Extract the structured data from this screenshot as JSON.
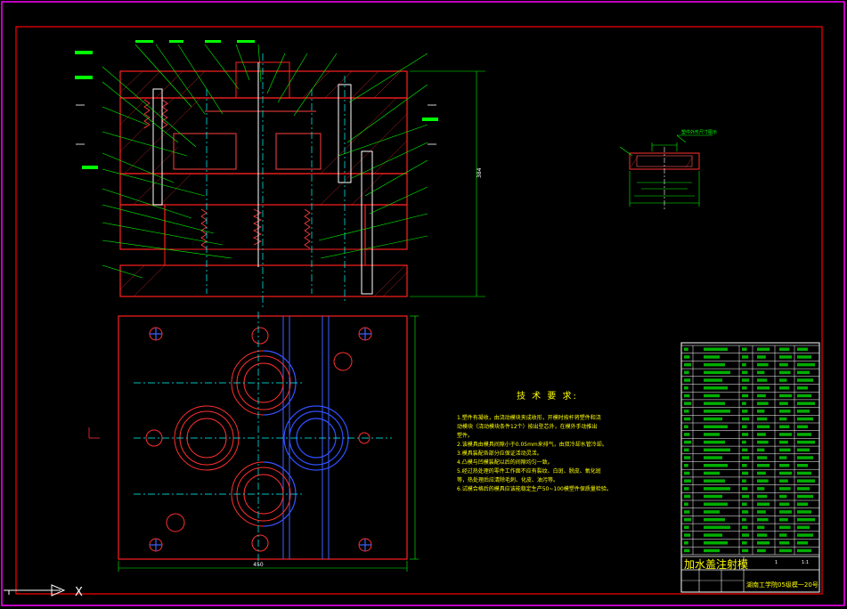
{
  "drawing": {
    "frame_color": "#ff00ff",
    "border_color": "#ff0000",
    "background": "#000000"
  },
  "tech_requirements": {
    "heading": "技 术 要 求:",
    "items": [
      "1.塑件有凝收，由浇动模块夹成收形，开模时按杆将塑件和浇",
      "   动模块（浇动模块条件12个）按出型芯外，在模外手动推出",
      "   塑件。",
      "2.该模具由模具间隙小于0.05mm来排气，由双冷却水管冷却。",
      "3.模具装配各部分应保证活动灵活。",
      "4.凸模与凹模装配以后的间隙均匀一致。",
      "5.经过热处理的零件工作面不应有裂纹、白斑、脱皮、氧化斑",
      "   等，热处理后应清除毛刺、化皮、油污等。",
      "6.试模合格后的模具应该能稳定生产50~100模塑件保质量检验。"
    ]
  },
  "title_block": {
    "drawing_name": "加水盖注射模",
    "school": "湖南工学院05级模一20号",
    "scale": "1:1",
    "sheet": "1"
  },
  "dims": {
    "right_overall": "384",
    "bottom_width": "450"
  },
  "part_detail": {
    "label": "塑件外形尺寸图示"
  },
  "ucs": {
    "x_label": "X"
  }
}
